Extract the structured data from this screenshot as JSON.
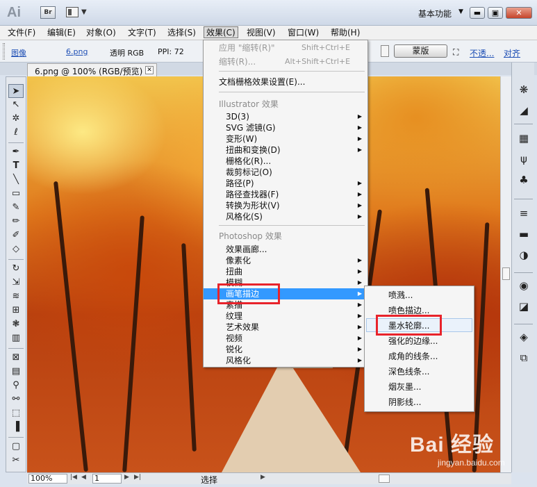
{
  "app": {
    "logo": "Ai",
    "bridge": "Br",
    "workspace": "基本功能"
  },
  "menubar": [
    {
      "label": "文件(F)"
    },
    {
      "label": "编辑(E)"
    },
    {
      "label": "对象(O)"
    },
    {
      "label": "文字(T)"
    },
    {
      "label": "选择(S)"
    },
    {
      "label": "效果(C)"
    },
    {
      "label": "视图(V)"
    },
    {
      "label": "窗口(W)"
    },
    {
      "label": "帮助(H)"
    }
  ],
  "controlbar": {
    "type_link": "图像",
    "file_link": "6.png",
    "mode": "透明 RGB",
    "ppi": "PPI: 72",
    "mask_button": "蒙版",
    "opacity_link": "不透...",
    "align_link": "对齐"
  },
  "document": {
    "tab_title": "6.png @ 100% (RGB/预览)"
  },
  "effect_menu": {
    "apply_last": {
      "label": "应用 \"缩转(R)\"",
      "shortcut": "Shift+Ctrl+E"
    },
    "last_effect": {
      "label": "缩转(R)...",
      "shortcut": "Alt+Shift+Ctrl+E"
    },
    "raster_settings": "文档栅格效果设置(E)...",
    "illustrator_header": "Illustrator 效果",
    "illustrator_items": [
      "3D(3)",
      "SVG 滤镜(G)",
      "变形(W)",
      "扭曲和变换(D)",
      "栅格化(R)...",
      "裁剪标记(O)",
      "路径(P)",
      "路径查找器(F)",
      "转换为形状(V)",
      "风格化(S)"
    ],
    "photoshop_header": "Photoshop 效果",
    "photoshop_items": [
      "效果画廊...",
      "像素化",
      "扭曲",
      "模糊",
      "画笔描边",
      "素描",
      "纹理",
      "艺术效果",
      "视频",
      "锐化",
      "风格化"
    ]
  },
  "brush_submenu": {
    "items": [
      "喷溅...",
      "喷色描边...",
      "墨水轮廓...",
      "强化的边缘...",
      "成角的线条...",
      "深色线条...",
      "烟灰墨...",
      "阴影线..."
    ]
  },
  "statusbar": {
    "zoom": "100%",
    "page": "1",
    "status": "选择"
  },
  "watermark": {
    "logo": "Bai 经验",
    "sub": "jingyan.baidu.com"
  },
  "colors": {
    "highlight": "#3399ff",
    "annotation_red": "#e8232b"
  }
}
